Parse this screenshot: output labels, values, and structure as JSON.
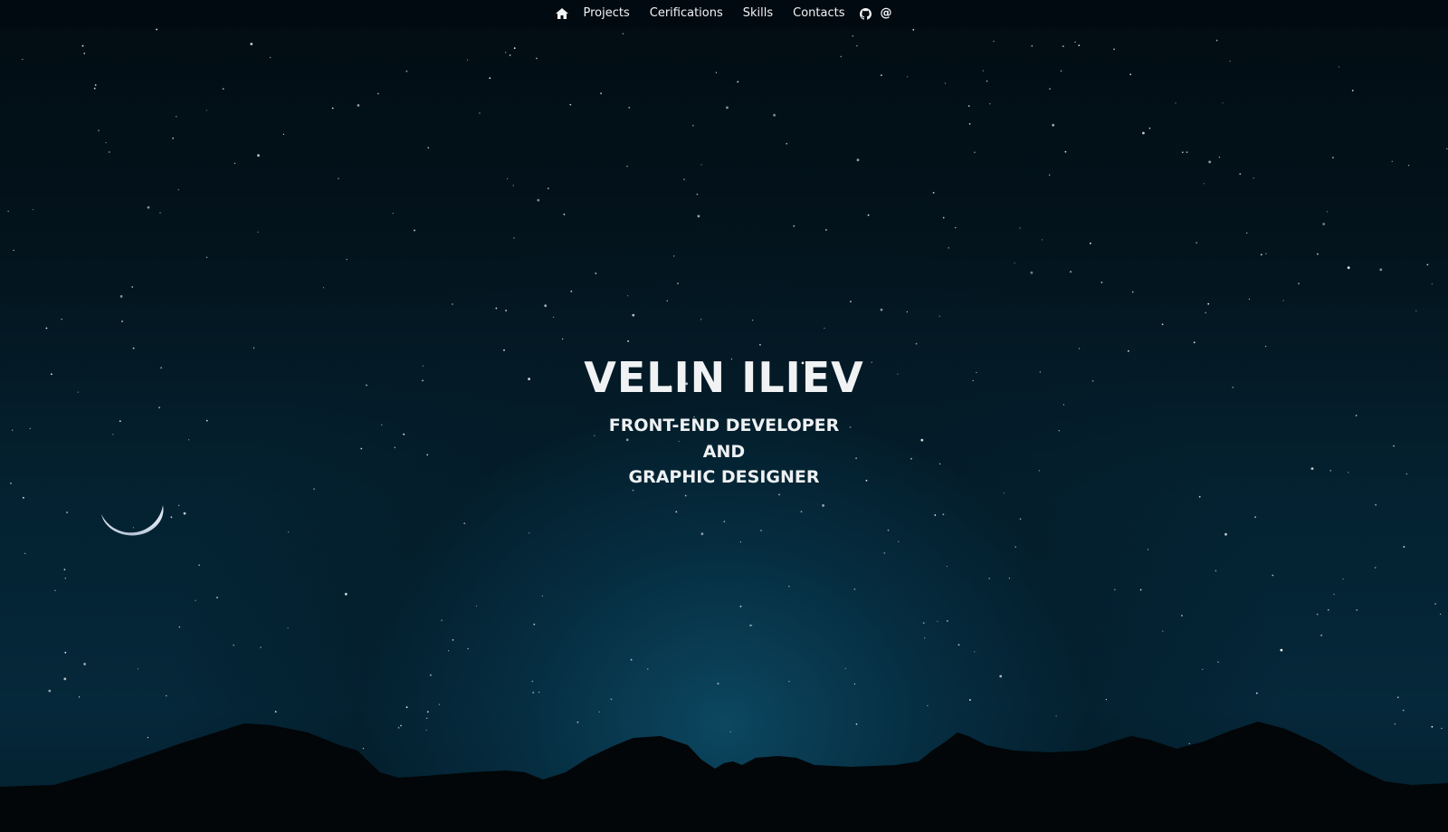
{
  "nav": {
    "home_icon": "home-icon",
    "items": [
      {
        "label": "Projects"
      },
      {
        "label": "Cerifications"
      },
      {
        "label": "Skills"
      },
      {
        "label": "Contacts"
      }
    ],
    "github_icon": "github-icon",
    "email_icon": "at-sign-icon",
    "email_glyph": "@"
  },
  "hero": {
    "name": "VELIN ILIEV",
    "subtitle_lines": [
      "FRONT-END DEVELOPER",
      "AND",
      "GRAPHIC DESIGNER"
    ]
  },
  "decor": {
    "moon_icon": "crescent-moon-icon",
    "stars": "starfield",
    "mountains": "mountain-silhouette"
  },
  "colors": {
    "sky_dark": "#020c12",
    "sky_glow": "#0c4862",
    "mountain": "#020608",
    "text": "#f0f2f4"
  }
}
